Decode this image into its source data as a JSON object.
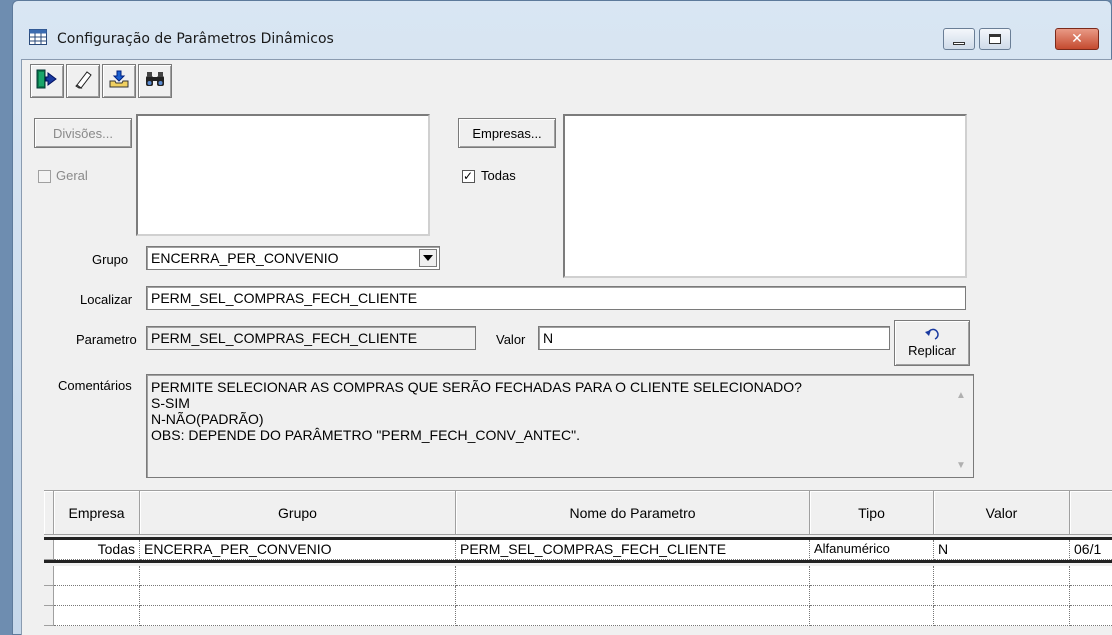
{
  "window": {
    "title": "Configuração de Parâmetros Dinâmicos",
    "close_glyph": "✕"
  },
  "toolbar": {
    "buttons": [
      {
        "icon": "exit-door-icon"
      },
      {
        "icon": "eraser-icon"
      },
      {
        "icon": "save-tray-icon"
      },
      {
        "icon": "binoculars-icon"
      }
    ]
  },
  "divisoes": {
    "button_label": "Divisões...",
    "geral_label": "Geral",
    "geral_checked": false
  },
  "empresas": {
    "button_label": "Empresas...",
    "todas_label": "Todas",
    "todas_checked": true
  },
  "grupo": {
    "label": "Grupo",
    "value": "ENCERRA_PER_CONVENIO"
  },
  "localizar": {
    "label": "Localizar",
    "value": "PERM_SEL_COMPRAS_FECH_CLIENTE"
  },
  "parametro": {
    "label": "Parametro",
    "value": "PERM_SEL_COMPRAS_FECH_CLIENTE"
  },
  "valor": {
    "label": "Valor",
    "value": "N"
  },
  "replicar": {
    "label": "Replicar",
    "icon": "undo-arrow-icon"
  },
  "comentarios": {
    "label": "Comentários",
    "lines": [
      "PERMITE SELECIONAR AS COMPRAS QUE SERÃO FECHADAS PARA O CLIENTE SELECIONADO?",
      "S-SIM",
      "N-NÃO(PADRÃO)",
      "OBS: DEPENDE DO PARÂMETRO \"PERM_FECH_CONV_ANTEC\"."
    ]
  },
  "grid": {
    "headers": [
      "Empresa",
      "Grupo",
      "Nome do Parametro",
      "Tipo",
      "Valor",
      ""
    ],
    "rows": [
      [
        "Todas",
        "ENCERRA_PER_CONVENIO",
        "PERM_SEL_COMPRAS_FECH_CLIENTE",
        "Alfanumérico",
        "N",
        "06/1"
      ]
    ]
  }
}
